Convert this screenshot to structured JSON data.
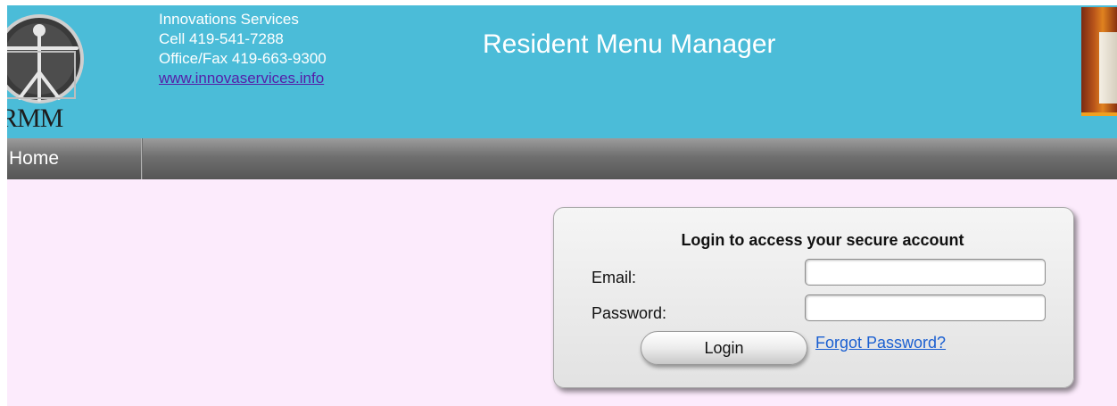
{
  "header": {
    "logo_text": "RMM",
    "company": "Innovations Services",
    "cell": "Cell 419-541-7288",
    "office": "Office/Fax 419-663-9300",
    "website": "www.innovaservices.info",
    "site_title": "Resident Menu Manager"
  },
  "nav": {
    "items": [
      {
        "label": "Home"
      }
    ]
  },
  "login": {
    "title": "Login to access your secure account",
    "email_label": "Email:",
    "email_value": "",
    "password_label": "Password:",
    "password_value": "",
    "button_label": "Login",
    "forgot_label": "Forgot Password?"
  },
  "colors": {
    "header_bg": "#4bbcd8",
    "page_bg": "#fcebfc",
    "link": "#1a5fd1"
  }
}
